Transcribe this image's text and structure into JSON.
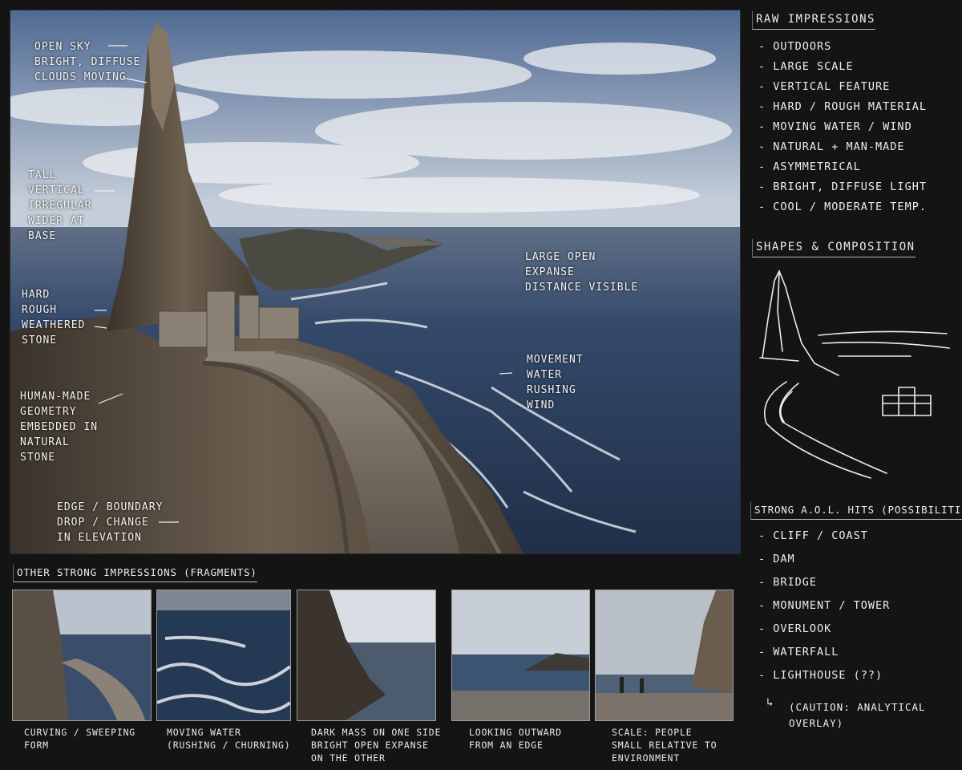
{
  "main_annotations": {
    "open_sky": "OPEN SKY\nBRIGHT, DIFFUSE\nCLOUDS MOVING",
    "tall_vertical": "TALL\nVERTICAL\nIRREGULAR\nWIDER AT\nBASE",
    "hard_rough": "HARD\nROUGH\nWEATHERED\nSTONE",
    "human_made": "HUMAN-MADE\nGEOMETRY\nEMBEDDED IN\nNATURAL\nSTONE",
    "edge_boundary": "EDGE / BOUNDARY\nDROP / CHANGE\nIN ELEVATION",
    "large_open": "LARGE OPEN\nEXPANSE\nDISTANCE VISIBLE",
    "movement": "MOVEMENT\nWATER\nRUSHING\nWIND"
  },
  "raw_impressions": {
    "title": "RAW IMPRESSIONS",
    "items": [
      "OUTDOORS",
      "LARGE SCALE",
      "VERTICAL FEATURE",
      "HARD / ROUGH MATERIAL",
      "MOVING WATER / WIND",
      "NATURAL + MAN-MADE",
      "ASYMMETRICAL",
      "BRIGHT, DIFFUSE LIGHT",
      "COOL / MODERATE TEMP."
    ]
  },
  "shapes": {
    "title": "SHAPES & COMPOSITION"
  },
  "aol": {
    "title": "STRONG A.O.L. HITS (POSSIBILITIES)",
    "items": [
      "CLIFF / COAST",
      "DAM",
      "BRIDGE",
      "MONUMENT / TOWER",
      "OVERLOOK",
      "WATERFALL",
      "LIGHTHOUSE (??)"
    ],
    "caution": "(CAUTION: ANALYTICAL\n      OVERLAY)"
  },
  "fragments": {
    "title": "OTHER STRONG IMPRESSIONS (FRAGMENTS)",
    "captions": [
      "CURVING / SWEEPING\n  FORM",
      "MOVING WATER\n(RUSHING / CHURNING)",
      "DARK MASS ON ONE SIDE\nBRIGHT OPEN EXPANSE\nON THE OTHER",
      "LOOKING OUTWARD\nFROM AN EDGE",
      "SCALE: PEOPLE\nSMALL RELATIVE TO\nENVIRONMENT"
    ]
  },
  "colors": {
    "background": "#141414",
    "ink": "#ececec",
    "sea": "#2f4866",
    "sky": "#c9d2de",
    "rock": "#5b5044"
  }
}
